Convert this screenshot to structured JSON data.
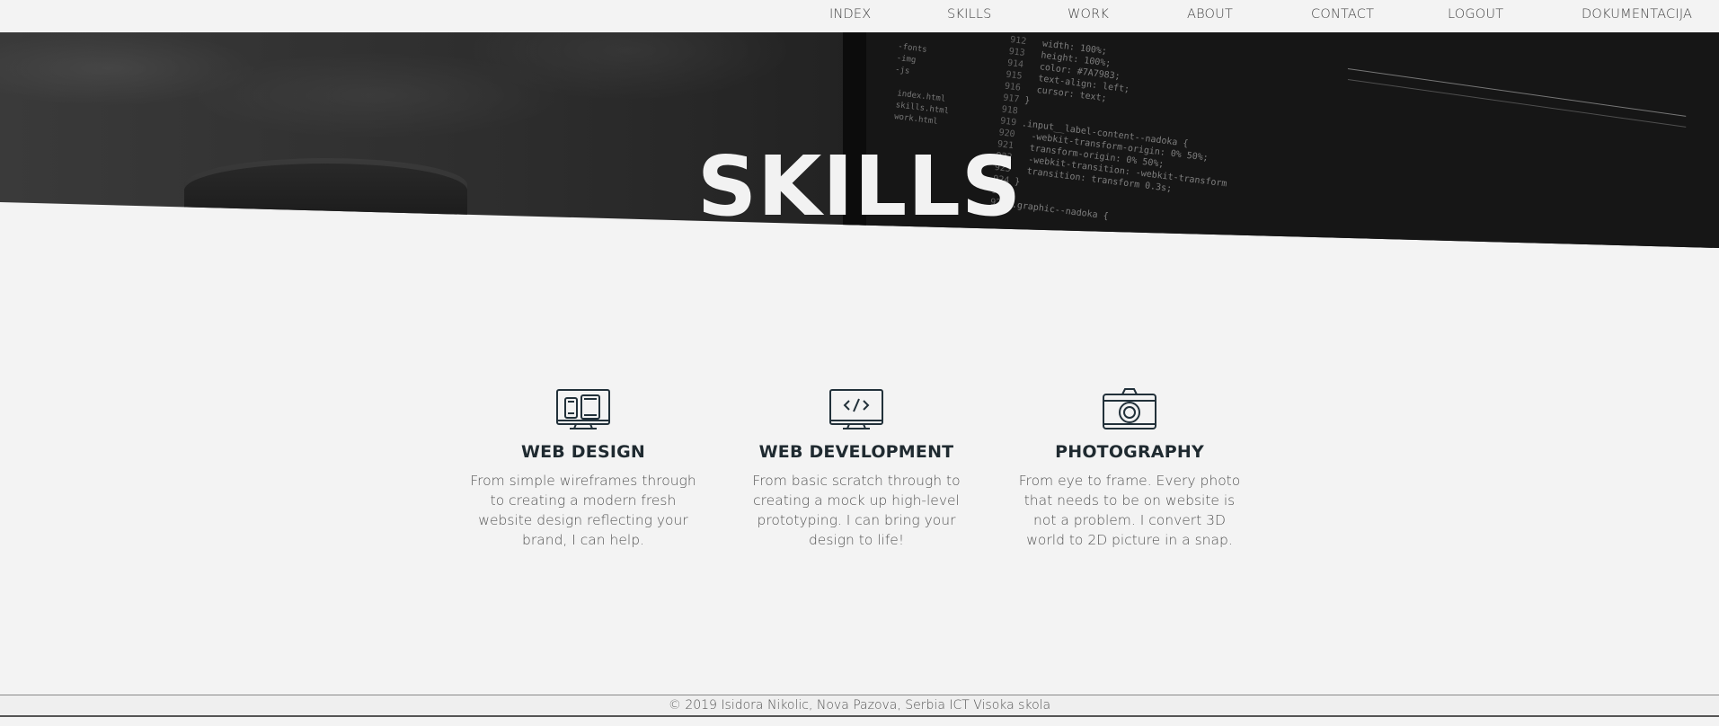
{
  "nav": {
    "items": [
      {
        "label": "INDEX"
      },
      {
        "label": "SKILLS"
      },
      {
        "label": "WORK"
      },
      {
        "label": "ABOUT"
      },
      {
        "label": "CONTACT"
      },
      {
        "label": "LOGOUT"
      },
      {
        "label": "DOKUMENTACIJA"
      }
    ]
  },
  "hero": {
    "title": "SKILLS"
  },
  "skills": [
    {
      "icon": "devices-icon",
      "title": "WEB DESIGN",
      "text": "From simple wireframes through to creating a modern fresh website design reflecting your brand, I can help."
    },
    {
      "icon": "code-monitor-icon",
      "title": "WEB DEVELOPMENT",
      "text": "From basic scratch through to creating a mock up high-level prototyping. I can bring your design to life!"
    },
    {
      "icon": "camera-icon",
      "title": "PHOTOGRAPHY",
      "text": "From eye to frame. Every photo that needs to be on website is not a problem. I convert 3D world to 2D picture in a snap."
    }
  ],
  "footer": {
    "text": "© 2019 Isidora Nikolic, Nova Pazova, Serbia ICT Visoka skola"
  },
  "colors": {
    "background": "#f3f3f3",
    "heading": "#1f2a30",
    "body_text": "#555555",
    "hero_title": "#f2f2f2"
  }
}
